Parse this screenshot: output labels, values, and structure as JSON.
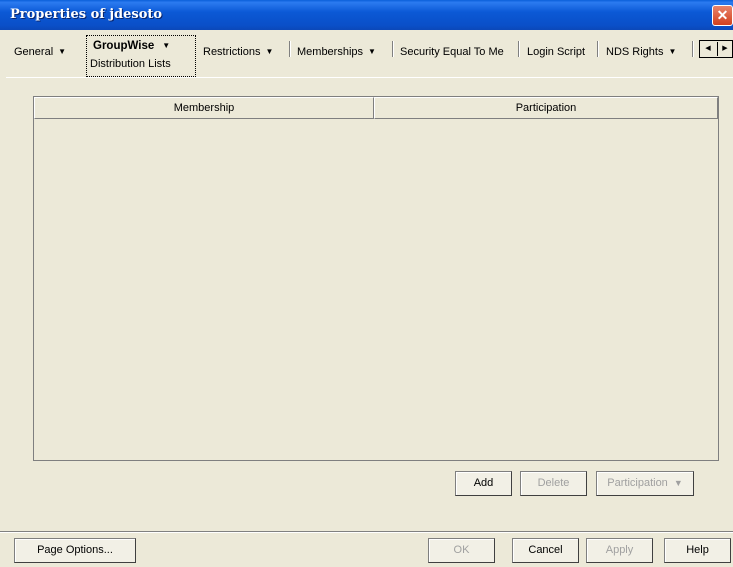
{
  "window": {
    "title": "Properties of jdesoto",
    "close_glyph": "✕"
  },
  "tabs": [
    {
      "label": "General",
      "has_menu": true
    },
    {
      "label": "GroupWise",
      "has_menu": true,
      "active": true,
      "subpage": "Distribution Lists"
    },
    {
      "label": "Restrictions",
      "has_menu": true
    },
    {
      "label": "Memberships",
      "has_menu": true
    },
    {
      "label": "Security Equal To Me",
      "has_menu": false
    },
    {
      "label": "Login Script",
      "has_menu": false
    },
    {
      "label": "NDS Rights",
      "has_menu": true
    }
  ],
  "table": {
    "columns": [
      "Membership",
      "Participation"
    ],
    "rows": []
  },
  "actions": {
    "add": "Add",
    "delete": "Delete",
    "participation": "Participation"
  },
  "footer": {
    "page_options": "Page Options...",
    "ok": "OK",
    "cancel": "Cancel",
    "apply": "Apply",
    "help": "Help"
  },
  "colors": {
    "titlebar": "#0A5FD9",
    "background": "#ECE9D8",
    "close": "#D2401E"
  }
}
